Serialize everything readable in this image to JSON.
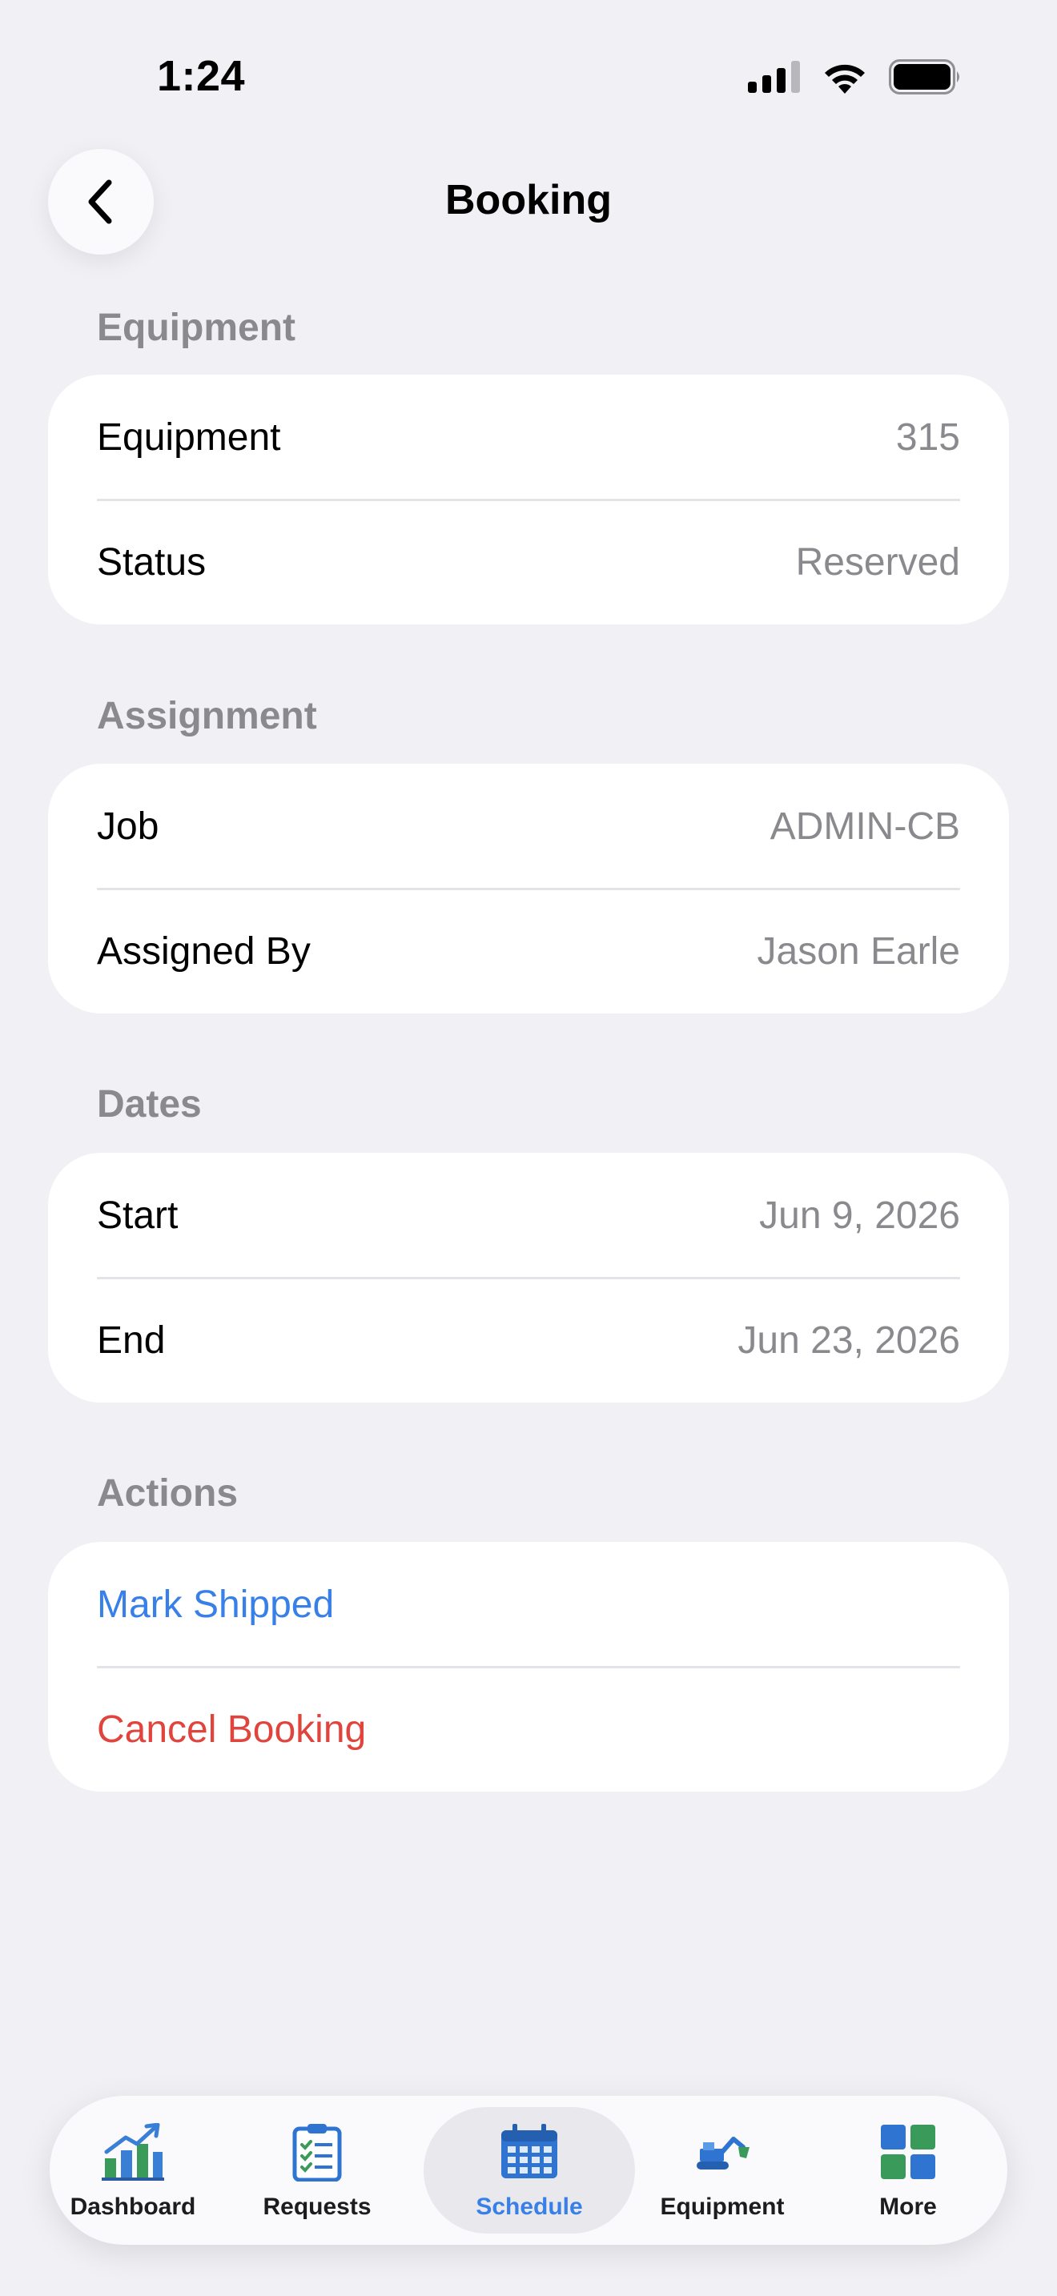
{
  "status_bar": {
    "time": "1:24",
    "icons": [
      "signal-icon",
      "wifi-icon",
      "battery-icon"
    ]
  },
  "nav": {
    "title": "Booking",
    "back_icon": "chevron-left-icon"
  },
  "sections": {
    "equipment": {
      "header": "Equipment",
      "rows": [
        {
          "label": "Equipment",
          "value": "315"
        },
        {
          "label": "Status",
          "value": "Reserved"
        }
      ]
    },
    "assignment": {
      "header": "Assignment",
      "rows": [
        {
          "label": "Job",
          "value": "ADMIN-CB"
        },
        {
          "label": "Assigned By",
          "value": "Jason Earle"
        }
      ]
    },
    "dates": {
      "header": "Dates",
      "rows": [
        {
          "label": "Start",
          "value": "Jun 9, 2026"
        },
        {
          "label": "End",
          "value": "Jun 23, 2026"
        }
      ]
    },
    "actions": {
      "header": "Actions",
      "mark_shipped": "Mark Shipped",
      "cancel_booking": "Cancel Booking"
    }
  },
  "tabbar": {
    "tabs": [
      {
        "label": "Dashboard",
        "icon": "chart-icon"
      },
      {
        "label": "Requests",
        "icon": "checklist-icon"
      },
      {
        "label": "Schedule",
        "icon": "calendar-icon",
        "active": true
      },
      {
        "label": "Equipment",
        "icon": "excavator-icon"
      },
      {
        "label": "More",
        "icon": "grid-icon"
      }
    ]
  },
  "colors": {
    "accent": "#3880e8",
    "destructive": "#e0443c",
    "background": "#f0f0f5",
    "secondary_text": "#8a8a8e"
  }
}
